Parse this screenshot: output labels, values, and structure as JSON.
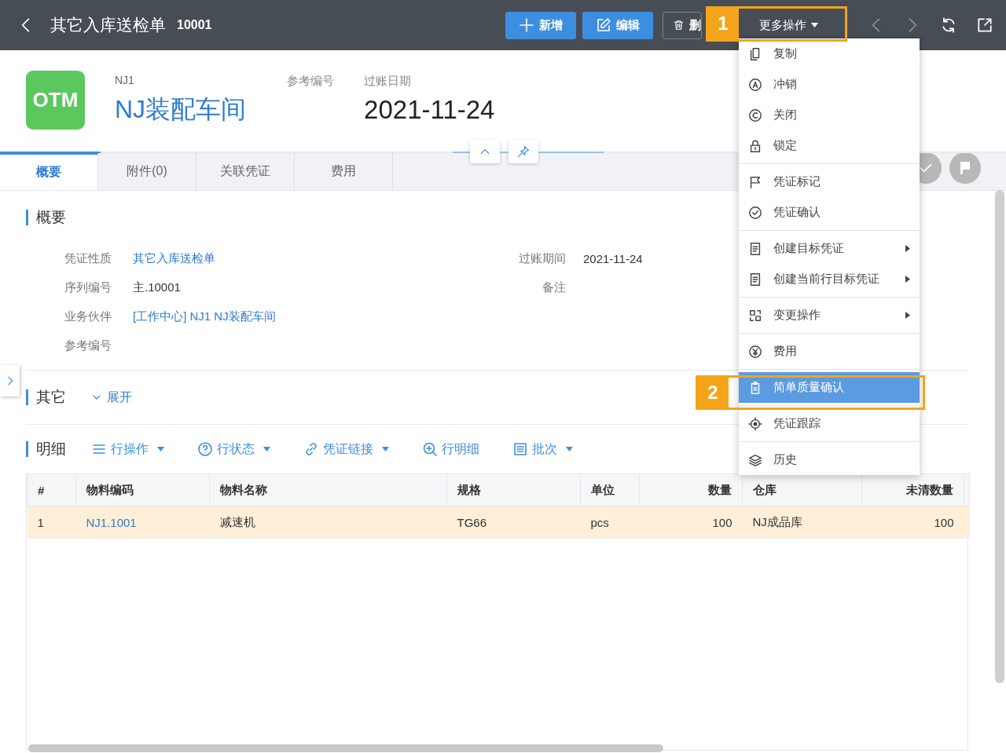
{
  "topbar": {
    "title": "其它入库送检单",
    "number": "10001",
    "buttons": [
      {
        "label": "新增",
        "kind": "primary"
      },
      {
        "label": "编辑",
        "kind": "primary"
      },
      {
        "label": "删",
        "kind": "outline"
      },
      {
        "label": "更多操作",
        "kind": "dropdown"
      }
    ]
  },
  "document": {
    "logo": "OTM",
    "code": "NJ1",
    "name": "NJ装配车间",
    "ref_label": "参考编号",
    "date_label": "过账日期",
    "date": "2021-11-24"
  },
  "tabs": [
    {
      "label": "概要",
      "selected": true
    },
    {
      "label": "附件(0)",
      "selected": false
    },
    {
      "label": "关联凭证",
      "selected": false
    },
    {
      "label": "费用",
      "selected": false
    }
  ],
  "summary": {
    "title": "概要",
    "left": [
      {
        "label": "凭证性质",
        "value": "其它入库送检单",
        "link": true
      },
      {
        "label": "序列编号",
        "value": "主.10001",
        "link": false
      },
      {
        "label": "业务伙伴",
        "value": "[工作中心] NJ1 NJ装配车间",
        "link": true
      },
      {
        "label": "参考编号"
      }
    ],
    "right": [
      {
        "label": "过账期间",
        "value": "2021-11-24",
        "link": false
      },
      {
        "label": "备注"
      }
    ]
  },
  "other": {
    "title": "其它",
    "expand": "展开"
  },
  "detail": {
    "title": "明细",
    "actions": [
      {
        "label": "行操作",
        "dropdown": true
      },
      {
        "label": "行状态",
        "dropdown": true
      },
      {
        "label": "凭证链接",
        "dropdown": true
      },
      {
        "label": "行明细",
        "dropdown": false
      },
      {
        "label": "批次",
        "dropdown": true
      }
    ],
    "table": {
      "columns": [
        {
          "label": "#",
          "kind": "text"
        },
        {
          "label": "物料编码",
          "kind": "link"
        },
        {
          "label": "物料名称",
          "kind": "text"
        },
        {
          "label": "规格",
          "kind": "text"
        },
        {
          "label": "单位",
          "kind": "text"
        },
        {
          "label": "数量",
          "kind": "number"
        },
        {
          "label": "仓库",
          "kind": "text"
        },
        {
          "label": "未清数量",
          "kind": "number"
        }
      ],
      "rows": [
        {
          "selected": true,
          "cells": [
            "1",
            "NJ1.1001",
            "减速机",
            "TG66",
            "pcs",
            "100",
            "NJ成品库",
            "100"
          ]
        }
      ]
    }
  },
  "menu": {
    "groups": [
      [
        {
          "label": "复制",
          "submenu": false,
          "selected": false
        },
        {
          "label": "冲销",
          "submenu": false,
          "selected": false
        },
        {
          "label": "关闭",
          "submenu": false,
          "selected": false
        },
        {
          "label": "锁定",
          "submenu": false,
          "selected": false
        }
      ],
      [
        {
          "label": "凭证标记",
          "submenu": false,
          "selected": false
        },
        {
          "label": "凭证确认",
          "submenu": false,
          "selected": false
        }
      ],
      [
        {
          "label": "创建目标凭证",
          "submenu": true,
          "selected": false
        },
        {
          "label": "创建当前行目标凭证",
          "submenu": true,
          "selected": false
        }
      ],
      [
        {
          "label": "变更操作",
          "submenu": true,
          "selected": false
        }
      ],
      [
        {
          "label": "费用",
          "submenu": false,
          "selected": false
        }
      ],
      [
        {
          "label": "简单质量确认",
          "submenu": false,
          "selected": true
        }
      ],
      [
        {
          "label": "凭证跟踪",
          "submenu": false,
          "selected": false
        }
      ],
      [
        {
          "label": "历史",
          "submenu": false,
          "selected": false
        }
      ]
    ]
  },
  "annotations": [
    {
      "label": "1"
    },
    {
      "label": "2"
    }
  ]
}
